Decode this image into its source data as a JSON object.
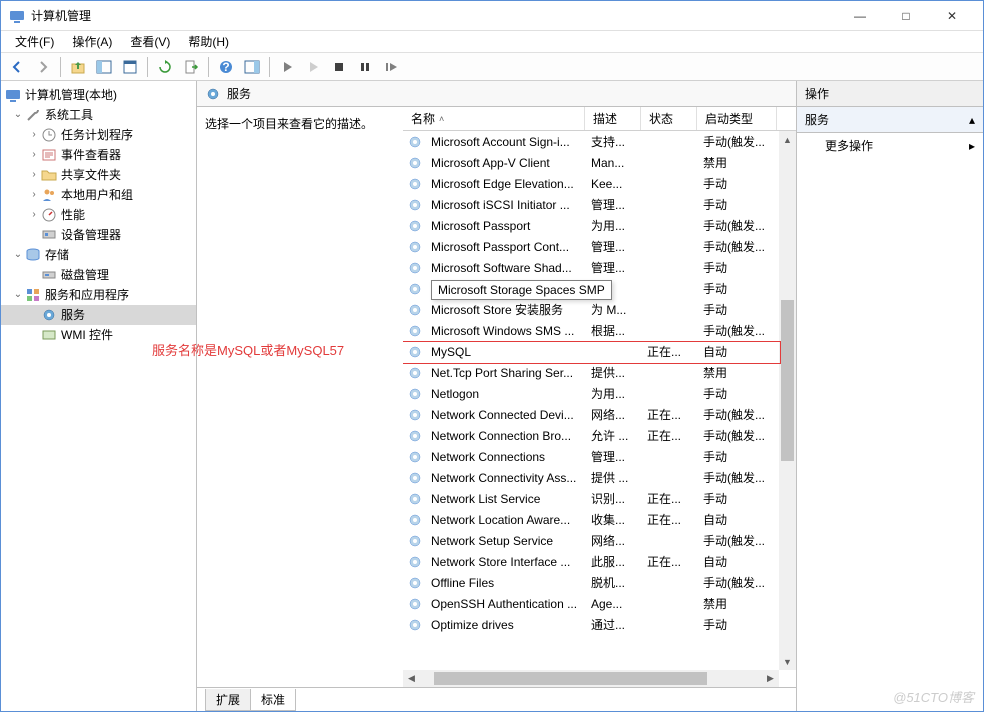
{
  "window": {
    "title": "计算机管理",
    "min": "—",
    "max": "□",
    "close": "✕"
  },
  "menus": [
    "文件(F)",
    "操作(A)",
    "查看(V)",
    "帮助(H)"
  ],
  "tree": {
    "root": "计算机管理(本地)",
    "sys_tools": "系统工具",
    "task_sched": "任务计划程序",
    "event_viewer": "事件查看器",
    "shared": "共享文件夹",
    "users": "本地用户和组",
    "perf": "性能",
    "devmgr": "设备管理器",
    "storage": "存储",
    "diskmgr": "磁盘管理",
    "svc_apps": "服务和应用程序",
    "services": "服务",
    "wmi": "WMI 控件"
  },
  "center": {
    "title": "服务",
    "hint": "选择一个项目来查看它的描述。",
    "tabs": {
      "ext": "扩展",
      "std": "标准"
    }
  },
  "columns": {
    "name": "名称",
    "desc": "描述",
    "status": "状态",
    "start": "启动类型"
  },
  "annotation": "服务名称是MySQL或者MySQL57",
  "tooltip": "Microsoft Storage Spaces SMP",
  "actions": {
    "header": "操作",
    "section": "服务",
    "more": "更多操作"
  },
  "watermark": "@51CTO博客",
  "services": [
    {
      "n": "Microsoft Account Sign-i...",
      "d": "支持...",
      "s": "",
      "t": "手动(触发..."
    },
    {
      "n": "Microsoft App-V Client",
      "d": "Man...",
      "s": "",
      "t": "禁用"
    },
    {
      "n": "Microsoft Edge Elevation...",
      "d": "Kee...",
      "s": "",
      "t": "手动"
    },
    {
      "n": "Microsoft iSCSI Initiator ...",
      "d": "管理...",
      "s": "",
      "t": "手动"
    },
    {
      "n": "Microsoft Passport",
      "d": "为用...",
      "s": "",
      "t": "手动(触发..."
    },
    {
      "n": "Microsoft Passport Cont...",
      "d": "管理...",
      "s": "",
      "t": "手动(触发..."
    },
    {
      "n": "Microsoft Software Shad...",
      "d": "管理...",
      "s": "",
      "t": "手动"
    },
    {
      "n": "Microsoft Storage Space...",
      "d": "",
      "s": "",
      "t": "手动"
    },
    {
      "n": "Microsoft Store 安装服务",
      "d": "为 M...",
      "s": "",
      "t": "手动"
    },
    {
      "n": "Microsoft Windows SMS ...",
      "d": "根据...",
      "s": "",
      "t": "手动(触发..."
    },
    {
      "n": "MySQL",
      "d": "",
      "s": "正在...",
      "t": "自动"
    },
    {
      "n": "Net.Tcp Port Sharing Ser...",
      "d": "提供...",
      "s": "",
      "t": "禁用"
    },
    {
      "n": "Netlogon",
      "d": "为用...",
      "s": "",
      "t": "手动"
    },
    {
      "n": "Network Connected Devi...",
      "d": "网络...",
      "s": "正在...",
      "t": "手动(触发..."
    },
    {
      "n": "Network Connection Bro...",
      "d": "允许 ...",
      "s": "正在...",
      "t": "手动(触发..."
    },
    {
      "n": "Network Connections",
      "d": "管理...",
      "s": "",
      "t": "手动"
    },
    {
      "n": "Network Connectivity Ass...",
      "d": "提供 ...",
      "s": "",
      "t": "手动(触发..."
    },
    {
      "n": "Network List Service",
      "d": "识别...",
      "s": "正在...",
      "t": "手动"
    },
    {
      "n": "Network Location Aware...",
      "d": "收集...",
      "s": "正在...",
      "t": "自动"
    },
    {
      "n": "Network Setup Service",
      "d": "网络...",
      "s": "",
      "t": "手动(触发..."
    },
    {
      "n": "Network Store Interface ...",
      "d": "此服...",
      "s": "正在...",
      "t": "自动"
    },
    {
      "n": "Offline Files",
      "d": "脱机...",
      "s": "",
      "t": "手动(触发..."
    },
    {
      "n": "OpenSSH Authentication ...",
      "d": "Age...",
      "s": "",
      "t": "禁用"
    },
    {
      "n": "Optimize drives",
      "d": "通过...",
      "s": "",
      "t": "手动"
    }
  ]
}
